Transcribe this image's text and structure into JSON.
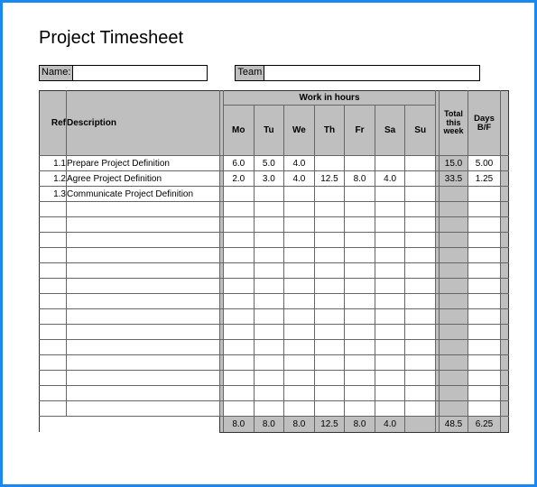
{
  "title": "Project Timesheet",
  "meta": {
    "name_label": "Name:",
    "name_value": "",
    "team_label": "Team",
    "team_value": ""
  },
  "headers": {
    "ref": "Ref",
    "description": "Description",
    "work_group": "Work in hours",
    "days": [
      "Mo",
      "Tu",
      "We",
      "Th",
      "Fr",
      "Sa",
      "Su"
    ],
    "total_week": "Total this week",
    "days_bf": "Days B/F"
  },
  "rows": [
    {
      "ref": "1.1",
      "desc": "Prepare Project Definition",
      "Mo": "6.0",
      "Tu": "5.0",
      "We": "4.0",
      "Th": "",
      "Fr": "",
      "Sa": "",
      "Su": "",
      "total": "15.0",
      "bf": "5.00"
    },
    {
      "ref": "1.2",
      "desc": "Agree Project Definition",
      "Mo": "2.0",
      "Tu": "3.0",
      "We": "4.0",
      "Th": "12.5",
      "Fr": "8.0",
      "Sa": "4.0",
      "Su": "",
      "total": "33.5",
      "bf": "1.25"
    },
    {
      "ref": "1.3",
      "desc": "Communicate Project Definition",
      "Mo": "",
      "Tu": "",
      "We": "",
      "Th": "",
      "Fr": "",
      "Sa": "",
      "Su": "",
      "total": "",
      "bf": ""
    },
    {
      "ref": "",
      "desc": "",
      "Mo": "",
      "Tu": "",
      "We": "",
      "Th": "",
      "Fr": "",
      "Sa": "",
      "Su": "",
      "total": "",
      "bf": ""
    },
    {
      "ref": "",
      "desc": "",
      "Mo": "",
      "Tu": "",
      "We": "",
      "Th": "",
      "Fr": "",
      "Sa": "",
      "Su": "",
      "total": "",
      "bf": ""
    },
    {
      "ref": "",
      "desc": "",
      "Mo": "",
      "Tu": "",
      "We": "",
      "Th": "",
      "Fr": "",
      "Sa": "",
      "Su": "",
      "total": "",
      "bf": ""
    },
    {
      "ref": "",
      "desc": "",
      "Mo": "",
      "Tu": "",
      "We": "",
      "Th": "",
      "Fr": "",
      "Sa": "",
      "Su": "",
      "total": "",
      "bf": ""
    },
    {
      "ref": "",
      "desc": "",
      "Mo": "",
      "Tu": "",
      "We": "",
      "Th": "",
      "Fr": "",
      "Sa": "",
      "Su": "",
      "total": "",
      "bf": ""
    },
    {
      "ref": "",
      "desc": "",
      "Mo": "",
      "Tu": "",
      "We": "",
      "Th": "",
      "Fr": "",
      "Sa": "",
      "Su": "",
      "total": "",
      "bf": ""
    },
    {
      "ref": "",
      "desc": "",
      "Mo": "",
      "Tu": "",
      "We": "",
      "Th": "",
      "Fr": "",
      "Sa": "",
      "Su": "",
      "total": "",
      "bf": ""
    },
    {
      "ref": "",
      "desc": "",
      "Mo": "",
      "Tu": "",
      "We": "",
      "Th": "",
      "Fr": "",
      "Sa": "",
      "Su": "",
      "total": "",
      "bf": ""
    },
    {
      "ref": "",
      "desc": "",
      "Mo": "",
      "Tu": "",
      "We": "",
      "Th": "",
      "Fr": "",
      "Sa": "",
      "Su": "",
      "total": "",
      "bf": ""
    },
    {
      "ref": "",
      "desc": "",
      "Mo": "",
      "Tu": "",
      "We": "",
      "Th": "",
      "Fr": "",
      "Sa": "",
      "Su": "",
      "total": "",
      "bf": ""
    },
    {
      "ref": "",
      "desc": "",
      "Mo": "",
      "Tu": "",
      "We": "",
      "Th": "",
      "Fr": "",
      "Sa": "",
      "Su": "",
      "total": "",
      "bf": ""
    },
    {
      "ref": "",
      "desc": "",
      "Mo": "",
      "Tu": "",
      "We": "",
      "Th": "",
      "Fr": "",
      "Sa": "",
      "Su": "",
      "total": "",
      "bf": ""
    },
    {
      "ref": "",
      "desc": "",
      "Mo": "",
      "Tu": "",
      "We": "",
      "Th": "",
      "Fr": "",
      "Sa": "",
      "Su": "",
      "total": "",
      "bf": ""
    },
    {
      "ref": "",
      "desc": "",
      "Mo": "",
      "Tu": "",
      "We": "",
      "Th": "",
      "Fr": "",
      "Sa": "",
      "Su": "",
      "total": "",
      "bf": ""
    }
  ],
  "totals": {
    "Mo": "8.0",
    "Tu": "8.0",
    "We": "8.0",
    "Th": "12.5",
    "Fr": "8.0",
    "Sa": "4.0",
    "Su": "",
    "total": "48.5",
    "bf": "6.25"
  }
}
